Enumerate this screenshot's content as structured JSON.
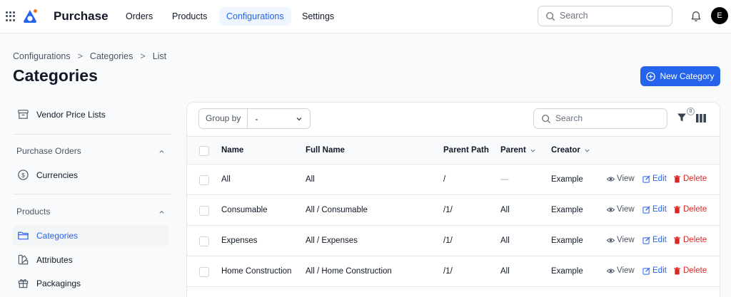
{
  "topbar": {
    "brand": "Purchase",
    "nav": [
      {
        "label": "Orders"
      },
      {
        "label": "Products"
      },
      {
        "label": "Configurations",
        "active": true
      },
      {
        "label": "Settings"
      }
    ],
    "search_placeholder": "Search",
    "avatar_initial": "E"
  },
  "breadcrumb": [
    "Configurations",
    "Categories",
    "List"
  ],
  "page_title": "Categories",
  "new_button_label": "New Category",
  "sidebar": {
    "items": [
      {
        "label": "Vendor Price Lists",
        "icon": "archive-icon"
      },
      {
        "group": "Purchase Orders"
      },
      {
        "label": "Currencies",
        "icon": "dollar-circle-icon"
      },
      {
        "group": "Products"
      },
      {
        "label": "Categories",
        "icon": "folder-icon",
        "active": true
      },
      {
        "label": "Attributes",
        "icon": "swatch-icon"
      },
      {
        "label": "Packagings",
        "icon": "gift-icon"
      }
    ]
  },
  "table": {
    "group_by_label": "Group by",
    "group_by_value": "-",
    "search_placeholder": "Search",
    "filter_count": "0",
    "columns": [
      "Name",
      "Full Name",
      "Parent Path",
      "Parent",
      "Creator"
    ],
    "rows": [
      {
        "name": "All",
        "full_name": "All",
        "parent_path": "/",
        "parent": "—",
        "creator": "Example"
      },
      {
        "name": "Consumable",
        "full_name": "All / Consumable",
        "parent_path": "/1/",
        "parent": "All",
        "creator": "Example"
      },
      {
        "name": "Expenses",
        "full_name": "All / Expenses",
        "parent_path": "/1/",
        "parent": "All",
        "creator": "Example"
      },
      {
        "name": "Home Construction",
        "full_name": "All / Home Construction",
        "parent_path": "/1/",
        "parent": "All",
        "creator": "Example"
      }
    ],
    "actions": {
      "view": "View",
      "edit": "Edit",
      "delete": "Delete"
    }
  },
  "colors": {
    "accent": "#2563eb",
    "danger": "#dc2626"
  }
}
